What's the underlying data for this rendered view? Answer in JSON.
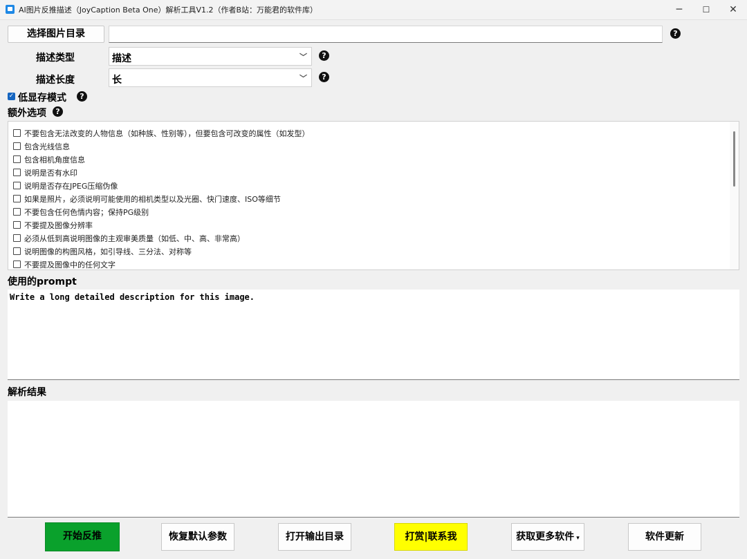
{
  "window": {
    "title": "AI图片反推描述（JoyCaption Beta One）解析工具V1.2（作者B站：万能君的软件库）",
    "minimize": "─",
    "maximize": "☐",
    "close": "✕"
  },
  "top": {
    "select_dir_label": "选择图片目录",
    "dir_value": "",
    "desc_type_label": "描述类型",
    "desc_type_value": "描述",
    "desc_length_label": "描述长度",
    "desc_length_value": "长",
    "low_vram_label": "低显存模式",
    "low_vram_checked": true,
    "extra_options_label": "额外选项",
    "help_glyph": "?"
  },
  "options": [
    "不要包含无法改变的人物信息（如种族、性别等），但要包含可改变的属性（如发型）",
    "包含光线信息",
    "包含相机角度信息",
    "说明是否有水印",
    "说明是否存在JPEG压缩伪像",
    "如果是照片，必须说明可能使用的相机类型以及光圈、快门速度、ISO等细节",
    "不要包含任何色情内容；保持PG级别",
    "不要提及图像分辨率",
    "必须从低到高说明图像的主观审美质量（如低、中、高、非常高）",
    "说明图像的构图风格，如引导线、三分法、对称等",
    "不要提及图像中的任何文字"
  ],
  "prompt": {
    "label": "使用的prompt",
    "text": "Write a long detailed description for this image."
  },
  "result": {
    "label": "解析结果",
    "text": ""
  },
  "buttons": {
    "start": "开始反推",
    "reset": "恢复默认参数",
    "open_output": "打开输出目录",
    "donate": "打赏|联系我",
    "more_software": "获取更多软件",
    "update": "软件更新"
  },
  "colors": {
    "start_bg": "#0aa12c",
    "donate_bg": "#ffff00"
  }
}
